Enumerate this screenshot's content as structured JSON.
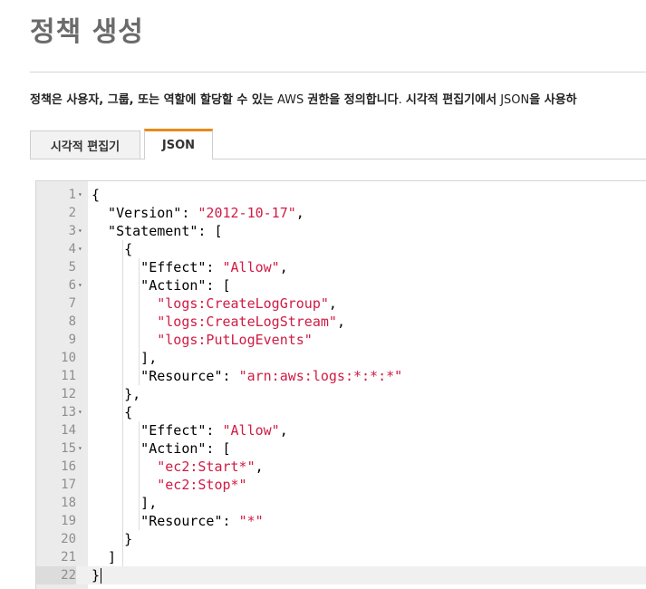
{
  "page": {
    "title": "정책 생성",
    "description_bold_1": "정책은 사용자, 그룹, 또는 역할에 할당할 수 있는",
    "description_normal_1": " AWS ",
    "description_bold_2": "권한을 정의합니다",
    "description_normal_2": ". ",
    "description_bold_3": "시각적 편집기에서",
    "description_normal_3": " JSON",
    "description_bold_4": "을 사용하"
  },
  "tabs": [
    {
      "label": "시각적 편집기",
      "active": false
    },
    {
      "label": "JSON",
      "active": true
    }
  ],
  "editor": {
    "active_line": 22,
    "lines": [
      {
        "n": "1",
        "fold": true,
        "tokens": [
          {
            "t": "{"
          }
        ]
      },
      {
        "n": "2",
        "fold": false,
        "tokens": [
          {
            "t": "  \"Version\": "
          },
          {
            "t": "\"2012-10-17\"",
            "s": true
          },
          {
            "t": ","
          }
        ]
      },
      {
        "n": "3",
        "fold": true,
        "tokens": [
          {
            "t": "  \"Statement\": ["
          }
        ]
      },
      {
        "n": "4",
        "fold": true,
        "tokens": [
          {
            "t": "    {"
          }
        ]
      },
      {
        "n": "5",
        "fold": false,
        "tokens": [
          {
            "t": "      \"Effect\": "
          },
          {
            "t": "\"Allow\"",
            "s": true
          },
          {
            "t": ","
          }
        ]
      },
      {
        "n": "6",
        "fold": true,
        "tokens": [
          {
            "t": "      \"Action\": ["
          }
        ]
      },
      {
        "n": "7",
        "fold": false,
        "tokens": [
          {
            "t": "        "
          },
          {
            "t": "\"logs:CreateLogGroup\"",
            "s": true
          },
          {
            "t": ","
          }
        ]
      },
      {
        "n": "8",
        "fold": false,
        "tokens": [
          {
            "t": "        "
          },
          {
            "t": "\"logs:CreateLogStream\"",
            "s": true
          },
          {
            "t": ","
          }
        ]
      },
      {
        "n": "9",
        "fold": false,
        "tokens": [
          {
            "t": "        "
          },
          {
            "t": "\"logs:PutLogEvents\"",
            "s": true
          }
        ]
      },
      {
        "n": "10",
        "fold": false,
        "tokens": [
          {
            "t": "      ],"
          }
        ]
      },
      {
        "n": "11",
        "fold": false,
        "tokens": [
          {
            "t": "      \"Resource\": "
          },
          {
            "t": "\"arn:aws:logs:*:*:*\"",
            "s": true
          }
        ]
      },
      {
        "n": "12",
        "fold": false,
        "tokens": [
          {
            "t": "    },"
          }
        ]
      },
      {
        "n": "13",
        "fold": true,
        "tokens": [
          {
            "t": "    {"
          }
        ]
      },
      {
        "n": "14",
        "fold": false,
        "tokens": [
          {
            "t": "      \"Effect\": "
          },
          {
            "t": "\"Allow\"",
            "s": true
          },
          {
            "t": ","
          }
        ]
      },
      {
        "n": "15",
        "fold": true,
        "tokens": [
          {
            "t": "      \"Action\": ["
          }
        ]
      },
      {
        "n": "16",
        "fold": false,
        "tokens": [
          {
            "t": "        "
          },
          {
            "t": "\"ec2:Start*\"",
            "s": true
          },
          {
            "t": ","
          }
        ]
      },
      {
        "n": "17",
        "fold": false,
        "tokens": [
          {
            "t": "        "
          },
          {
            "t": "\"ec2:Stop*\"",
            "s": true
          }
        ]
      },
      {
        "n": "18",
        "fold": false,
        "tokens": [
          {
            "t": "      ],"
          }
        ]
      },
      {
        "n": "19",
        "fold": false,
        "tokens": [
          {
            "t": "      \"Resource\": "
          },
          {
            "t": "\"*\"",
            "s": true
          }
        ]
      },
      {
        "n": "20",
        "fold": false,
        "tokens": [
          {
            "t": "    }"
          }
        ]
      },
      {
        "n": "21",
        "fold": false,
        "tokens": [
          {
            "t": "  ]"
          }
        ]
      },
      {
        "n": "22",
        "fold": false,
        "tokens": [
          {
            "t": "}"
          }
        ]
      }
    ]
  },
  "colors": {
    "string": "#d11b43",
    "active_tab_accent": "#e88a1a",
    "gutter": "#ebebeb"
  }
}
